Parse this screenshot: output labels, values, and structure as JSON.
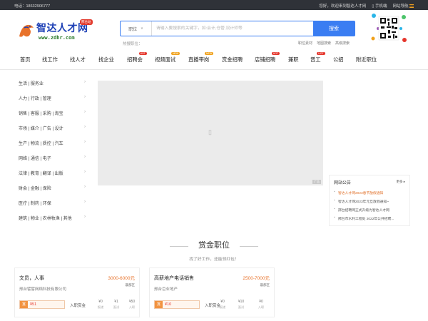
{
  "topbar": {
    "phone": "电话：18632906777",
    "welcome": "您好，欢迎来到智达人才网",
    "mobile": "手机端",
    "site_nav": "网站导航"
  },
  "logo": {
    "name": "智达人才网",
    "domain": "www.zdhr.com",
    "badge": "邢台站"
  },
  "search": {
    "type_label": "职位",
    "placeholder": "请输入要搜索的关键字，如:会计,仓管,设计师等",
    "button_label": "搜索",
    "hot_label": "热搜职位："
  },
  "quick_links": [
    "职位素材",
    "地图搜索",
    "高级搜索"
  ],
  "nav": {
    "items": [
      {
        "label": "首页",
        "tag": ""
      },
      {
        "label": "找工作",
        "tag": ""
      },
      {
        "label": "找人才",
        "tag": ""
      },
      {
        "label": "找企业",
        "tag": ""
      },
      {
        "label": "招聘会",
        "tag": "HOT"
      },
      {
        "label": "视频面试",
        "tag": "NEW"
      },
      {
        "label": "直播带岗",
        "tag": "NEW"
      },
      {
        "label": "赏金招聘",
        "tag": ""
      },
      {
        "label": "店铺招聘",
        "tag": "HOT"
      },
      {
        "label": "兼职",
        "tag": ""
      },
      {
        "label": "普工",
        "tag": "HOT"
      },
      {
        "label": "公招",
        "tag": ""
      },
      {
        "label": "附近职位",
        "tag": ""
      }
    ]
  },
  "categories": [
    "生活 | 服务业",
    "人力 | 行政 | 管理",
    "销售 | 客服 | 采购 | 淘宝",
    "市场 | 媒介 | 广告 | 设计",
    "生产 | 物流 | 质控 | 汽车",
    "网络 | 通信 | 电子",
    "法律 | 教育 | 翻译 | 出版",
    "财会 | 金融 | 保险",
    "医疗 | 制药 | 环保",
    "建筑 | 物业 | 农林牧渔 | 其他"
  ],
  "banner": {
    "ad_label": "广告"
  },
  "notice": {
    "title": "网站公告",
    "more": "更多",
    "items": [
      "智达人才网2023春节放假通知",
      "智达人才网2023年元旦放假通知~",
      "邢台招聘网正式升级为智达人才网",
      "邢台市水利工程处 2022年公开招聘..."
    ]
  },
  "section": {
    "title": "赏金职位",
    "subtitle": "找了好工作，还能领红包！"
  },
  "jobs": [
    {
      "title": "文员，人事",
      "salary": "3000-6000元",
      "company": "邢台譬譬网络科技有限公司",
      "area": "襄都区",
      "bonus": "¥51",
      "bonus_label": "入职赏金",
      "stats": [
        {
          "n": "¥0",
          "t": "报递"
        },
        {
          "n": "¥1",
          "t": "面试"
        },
        {
          "n": "¥50",
          "t": "入职"
        }
      ]
    },
    {
      "title": "高薪地产电话销售",
      "salary": "2500-7000元",
      "company": "邢台巨业地产",
      "area": "襄都区",
      "bonus": "¥10",
      "bonus_label": "入职赏金",
      "stats": [
        {
          "n": "¥0",
          "t": "报递"
        },
        {
          "n": "¥10",
          "t": "面试"
        },
        {
          "n": "¥0",
          "t": "入职"
        }
      ]
    }
  ],
  "colors": {
    "accent": "#3a7df2",
    "salary": "#e8722a",
    "topbar": "#2f3238",
    "hot_tag": "#e5352b",
    "new_tag": "#f0a11a"
  }
}
